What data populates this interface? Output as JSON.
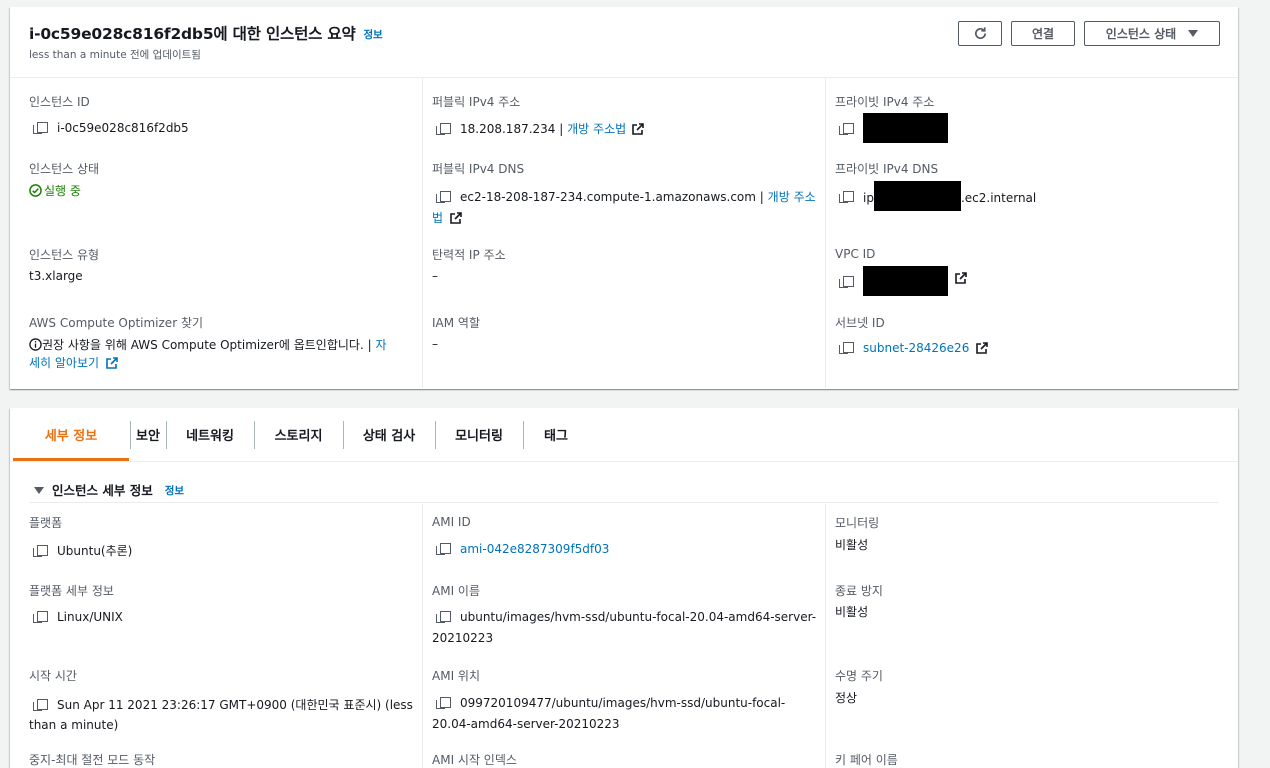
{
  "summary": {
    "title": "i-0c59e028c816f2db5에 대한 인스턴스 요약",
    "info": "정보",
    "subtitle": "less than a minute 전에 업데이트됨",
    "connect_label": "연결",
    "state_menu_label": "인스턴스 상태"
  },
  "fields": {
    "instance_id_label": "인스턴스 ID",
    "instance_id": "i-0c59e028c816f2db5",
    "public_ipv4_label": "퍼블릭 IPv4 주소",
    "public_ipv4": "18.208.187.234",
    "sep": "|",
    "open_address": "개방 주소법",
    "private_ipv4_label": "프라이빗 IPv4 주소",
    "instance_state_label": "인스턴스 상태",
    "instance_state": "실행 중",
    "public_dns_label": "퍼블릭 IPv4 DNS",
    "public_dns": "ec2-18-208-187-234.compute-1.amazonaws.com",
    "open_address_part1": "개방 주소",
    "open_address_part2": "법",
    "private_dns_label": "프라이빗 IPv4 DNS",
    "private_dns_prefix": "ip",
    "private_dns_suffix": ".ec2.internal",
    "instance_type_label": "인스턴스 유형",
    "instance_type": "t3.xlarge",
    "elastic_ip_label": "탄력적 IP 주소",
    "elastic_ip": "–",
    "vpc_id_label": "VPC ID",
    "optimizer_label": "AWS Compute Optimizer 찾기",
    "optimizer_text": "권장 사항을 위해 AWS Compute Optimizer에 옵트인합니다. |",
    "optimizer_link1": "자",
    "optimizer_link2": "세히 알아보기",
    "iam_role_label": "IAM 역할",
    "iam_role": "–",
    "subnet_id_label": "서브넷 ID",
    "subnet_id": "subnet-28426e26"
  },
  "tabs": [
    "세부 정보",
    "보안",
    "네트워킹",
    "스토리지",
    "상태 검사",
    "모니터링",
    "태그"
  ],
  "details": {
    "section_title": "인스턴스 세부 정보",
    "section_info": "정보",
    "platform_label": "플랫폼",
    "platform": "Ubuntu(추론)",
    "ami_id_label": "AMI ID",
    "ami_id": "ami-042e8287309f5df03",
    "monitoring_label": "모니터링",
    "monitoring": "비활성",
    "platform_details_label": "플랫폼 세부 정보",
    "platform_details": "Linux/UNIX",
    "ami_name_label": "AMI 이름",
    "ami_name_line1": "ubuntu/images/hvm-ssd/ubuntu-focal-20.04-amd64-server-",
    "ami_name_line2": "20210223",
    "termination_label": "종료 방지",
    "termination": "비활성",
    "launch_time_label": "시작 시간",
    "launch_time_line1": "Sun Apr 11 2021 23:26:17 GMT+0900 (대한민국 표준시) (less",
    "launch_time_line2": "than a minute)",
    "ami_location_label": "AMI 위치",
    "ami_location_line1": "099720109477/ubuntu/images/hvm-ssd/ubuntu-focal-",
    "ami_location_line2": "20.04-amd64-server-20210223",
    "lifecycle_label": "수명 주기",
    "lifecycle": "정상",
    "stop_hibernate_label": "중지-최대 절전 모드 동작",
    "ami_launch_index_label": "AMI 시작 인덱스",
    "key_pair_label": "키 페어 이름"
  },
  "colors": {
    "link": "#0073bb",
    "active_tab": "#ec7211",
    "running": "#1d8102"
  }
}
